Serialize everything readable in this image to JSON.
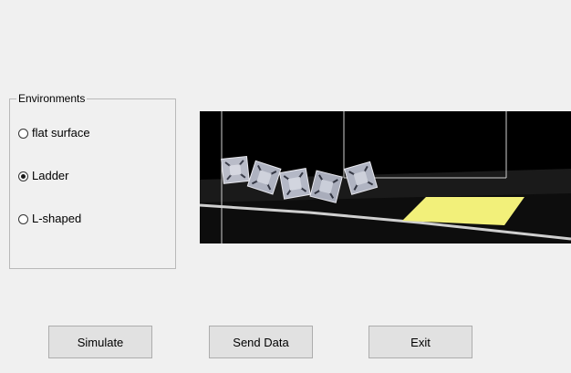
{
  "environments": {
    "title": "Environments",
    "options": [
      {
        "label": "flat surface",
        "selected": false
      },
      {
        "label": "Ladder",
        "selected": true
      },
      {
        "label": "L-shaped",
        "selected": false
      }
    ]
  },
  "viewport": {
    "background": "#000000",
    "target_color": "#f2f07a",
    "ground_line_color": "#cfcfcf"
  },
  "buttons": {
    "simulate": "Simulate",
    "send_data": "Send Data",
    "exit": "Exit"
  }
}
